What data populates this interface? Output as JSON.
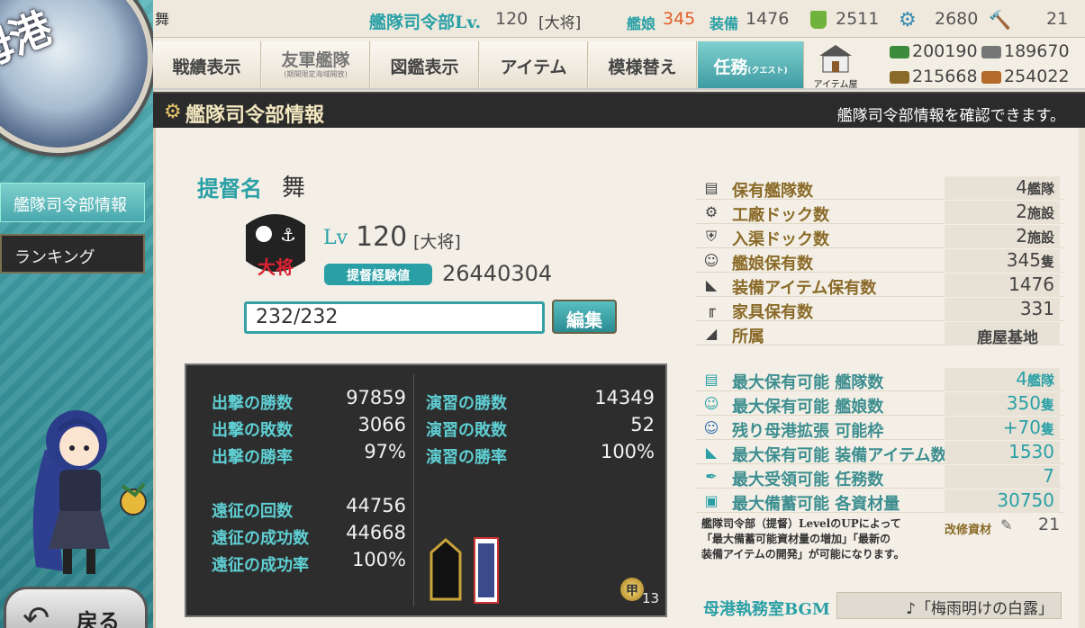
{
  "home": {
    "label": "母港",
    "back_label": "戻る"
  },
  "top": {
    "admiral_name": "舞",
    "hq_label": "艦隊司令部Lv.",
    "hq_level": "120",
    "rank": "[大将]",
    "ships_label": "艦娘",
    "ships_count": "345",
    "equip_label": "装備",
    "equip_count": "1476",
    "bucket": "2511",
    "devmat": "2680",
    "screw": "21"
  },
  "nav": {
    "record": "戦績表示",
    "friend_fleet": "友軍艦隊",
    "friend_fleet_sub": "(期間限定海域開放)",
    "album": "図鑑表示",
    "items": "アイテム",
    "interior": "模様替え",
    "quest": "任務",
    "quest_sub": "(クエスト)",
    "item_shop": "アイテム屋"
  },
  "resources": {
    "fuel": "200190",
    "steel": "189670",
    "ammo": "215668",
    "bauxite": "254022"
  },
  "header": {
    "title": "艦隊司令部情報",
    "description": "艦隊司令部情報を確認できます。"
  },
  "sidebar": {
    "items": [
      {
        "label": "艦隊司令部情報"
      },
      {
        "label": "ランキング"
      }
    ]
  },
  "profile": {
    "admiral_label": "提督名",
    "admiral_name": "舞",
    "lv_label": "Lv",
    "lv_value": "120",
    "rank": "[大将]",
    "emblem_rank": "大将",
    "exp_label": "提督経験値",
    "exp_value": "26440304",
    "comment": "232/232",
    "edit_label": "編集"
  },
  "record": {
    "sortie_wins_label": "出撃の勝数",
    "sortie_wins": "97859",
    "sortie_losses_label": "出撃の敗数",
    "sortie_losses": "3066",
    "sortie_rate_label": "出撃の勝率",
    "sortie_rate": "97%",
    "exercise_wins_label": "演習の勝数",
    "exercise_wins": "14349",
    "exercise_losses_label": "演習の敗数",
    "exercise_losses": "52",
    "exercise_rate_label": "演習の勝率",
    "exercise_rate": "100%",
    "expedition_count_label": "遠征の回数",
    "expedition_count": "44756",
    "expedition_success_label": "遠征の成功数",
    "expedition_success": "44668",
    "expedition_rate_label": "遠征の成功率",
    "expedition_rate": "100%",
    "medal_kou": "甲",
    "medal_count": "13"
  },
  "info": [
    {
      "label": "保有艦隊数",
      "value": "4",
      "unit": "艦隊",
      "icon": "fleet-icon"
    },
    {
      "label": "工廠ドック数",
      "value": "2",
      "unit": "施設",
      "icon": "gear-icon"
    },
    {
      "label": "入渠ドック数",
      "value": "2",
      "unit": "施設",
      "icon": "repair-icon"
    },
    {
      "label": "艦娘保有数",
      "value": "345",
      "unit": "隻",
      "icon": "shipgirl-icon"
    },
    {
      "label": "装備アイテム保有数",
      "value": "1476",
      "unit": "",
      "icon": "equipment-icon"
    },
    {
      "label": "家具保有数",
      "value": "331",
      "unit": "",
      "icon": "furniture-icon"
    },
    {
      "label": "所属",
      "value": "鹿屋基地",
      "unit": "",
      "icon": "base-icon"
    }
  ],
  "limits": [
    {
      "label": "最大保有可能 艦隊数",
      "value": "4",
      "unit": "艦隊",
      "icon": "fleet-icon"
    },
    {
      "label": "最大保有可能 艦娘数",
      "value": "350",
      "unit": "隻",
      "icon": "shipgirl-icon"
    },
    {
      "label": "残り母港拡張 可能枠",
      "value": "+70",
      "unit": "隻",
      "icon": "port-expansion-icon"
    },
    {
      "label": "最大保有可能 装備アイテム数",
      "value": "1530",
      "unit": "",
      "icon": "equipment-icon"
    },
    {
      "label": "最大受領可能 任務数",
      "value": "7",
      "unit": "",
      "icon": "quill-icon"
    },
    {
      "label": "最大備蓄可能 各資材量",
      "value": "30750",
      "unit": "",
      "icon": "storage-icon"
    }
  ],
  "note": {
    "line1": "艦隊司令部（提督）LevelのUPによって",
    "line2": "「最大備蓄可能資材量の増加」「最新の",
    "line3": "装備アイテムの開発」が可能になります。",
    "kaishu_label": "改修資材",
    "kaishu_value": "21"
  },
  "bgm": {
    "label": "母港執務室BGM",
    "value": "♪「梅雨明けの白露」"
  },
  "colors": {
    "teal": "#2aa0a6",
    "gold": "#8a6a28",
    "dark": "#2d2d2d",
    "ships_count": "#e0602a"
  }
}
